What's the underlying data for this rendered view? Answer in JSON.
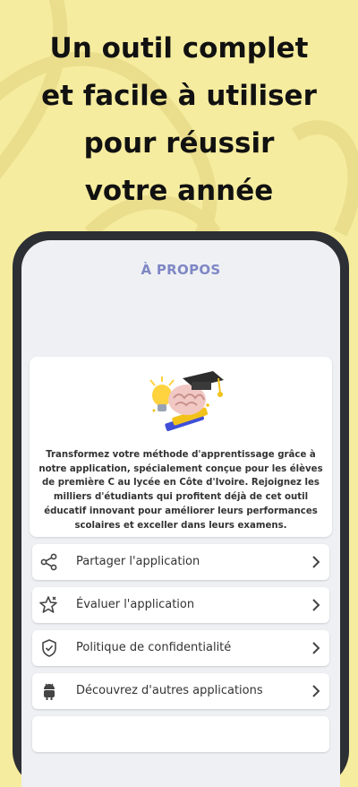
{
  "headline": {
    "lines": [
      "Un outil complet",
      "et facile à utiliser",
      "pour réussir",
      "votre année"
    ]
  },
  "app": {
    "title": "À PROPOS",
    "description": "Transformez votre méthode d'apprentissage grâce à notre application, spécialement conçue pour les élèves de première C au lycée en Côte d'Ivoire. Rejoignez les milliers d'étudiants qui profitent déjà de cet outil éducatif innovant pour améliorer leurs performances scolaires et exceller dans leurs examens.",
    "menu": [
      {
        "label": "Partager l'application",
        "icon": "share-icon"
      },
      {
        "label": "Évaluer l'application",
        "icon": "star-icon"
      },
      {
        "label": "Politique de confidentialité",
        "icon": "shield-check-icon"
      },
      {
        "label": "Découvrez d'autres applications",
        "icon": "android-icon"
      }
    ]
  },
  "colors": {
    "background": "#f6ec9f",
    "title": "#7f87c4",
    "phone_frame": "#2c2f33",
    "screen": "#eef0f4"
  }
}
